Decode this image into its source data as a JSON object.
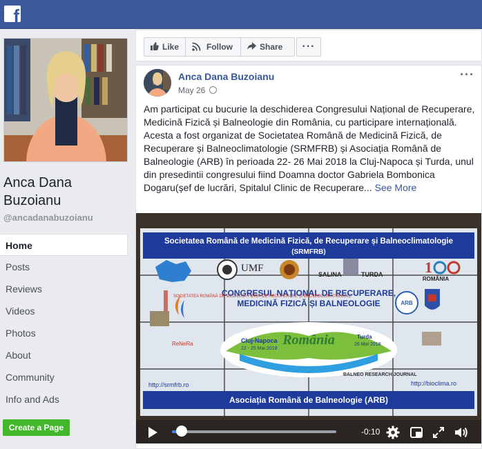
{
  "header": {
    "logo_letter": "f"
  },
  "sidebar": {
    "page_name": "Anca Dana Buzoianu",
    "handle": "@ancadanabuzoianu",
    "nav": [
      {
        "label": "Home",
        "active": true
      },
      {
        "label": "Posts"
      },
      {
        "label": "Reviews"
      },
      {
        "label": "Videos"
      },
      {
        "label": "Photos"
      },
      {
        "label": "About"
      },
      {
        "label": "Community"
      },
      {
        "label": "Info and Ads"
      }
    ],
    "create_page_label": "Create a Page"
  },
  "actions": {
    "like": "Like",
    "follow": "Follow",
    "share": "Share",
    "more": "···"
  },
  "post": {
    "author": "Anca Dana Buzoianu",
    "date": "May 26",
    "menu": "···",
    "paragraph1": "Am participat cu bucurie la deschiderea Congresului Național de Recuperare, Medicină Fizică și Balneologie din România, cu participare internațională.",
    "paragraph2": "Acesta a fost organizat de Societatea Română de Medicină Fizică, de Recuperare și Balneoclimatologie (SRMFRB) și Asociația Română de Balneologie (ARB) în perioada 22- 26 Mai 2018 la Cluj-Napoca și Turda, unul din presedintii congresului fiind Doamna doctor Gabriela Bombonica Dogaru(șef de lucrări, Spitalul Clinic de Recuperare...",
    "see_more": "See More"
  },
  "video": {
    "banner_top": "Societatea Română de Medicină Fizică, de Recuperare și Balneoclimatologie",
    "banner_top_abbr": "(SRMFRB)",
    "logo_umf": "UMF",
    "logo_salina": "SALINA",
    "logo_turda": "TURDA",
    "logo_romania100": "ROMÂNIA",
    "logo_arb": "ARB",
    "congress_line1": "CONGRESUL NAȚIONAL DE RECUPERARE,",
    "congress_line2": "MEDICINĂ FIZICĂ ȘI BALNEOLOGIE",
    "sideline": "SOCIETATEA ROMÂNĂ DE MEDICINĂ FIZICĂ DE RECUPERARE ȘI BALNEOCLIMATOLOGIE",
    "city_left": "Cluj-Napoca",
    "dates_left": "22 - 25 Mai 2018",
    "romania_word": "România",
    "city_right": "Turda",
    "dates_right": "26 Mai 2018",
    "url_left": "http://srmfrb.ro",
    "url_right": "http://bioclima.ro",
    "balneo_journal": "BALNEO RESEARCH JOURNAL",
    "banner_bottom": "Asociația Română de Balneologie (ARB)",
    "time_remaining": "-0:10",
    "progress": 0.06
  }
}
